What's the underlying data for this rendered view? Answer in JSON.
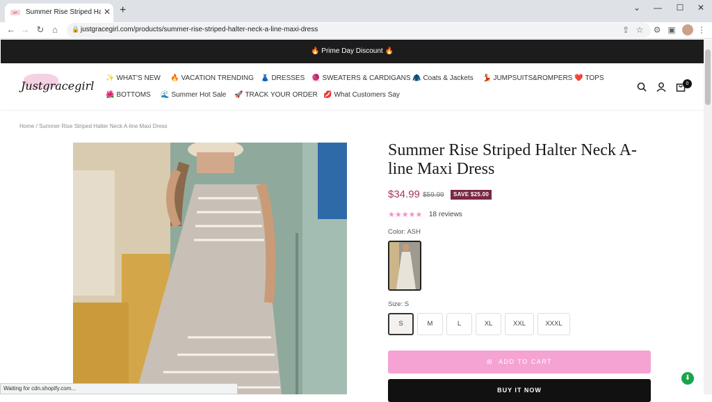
{
  "browser": {
    "tab_title": "Summer Rise Striped Halter Neck A-line Maxi Dress",
    "tab_favicon_text": "jgirl",
    "url": "justgracegirl.com/products/summer-rise-striped-halter-neck-a-line-maxi-dress",
    "new_tab": "+",
    "close": "✕",
    "minimize": "—",
    "maximize": "☐",
    "window_close": "✕",
    "collapse": "⌄"
  },
  "announcement": "🔥 Prime Day Discount 🔥",
  "header": {
    "logo_text": "Justgracegirl",
    "menu": [
      {
        "icon": "✨",
        "label": "WHAT'S NEW"
      },
      {
        "icon": "🔥",
        "label": "VACATION TRENDING"
      },
      {
        "icon": "👗",
        "label": "DRESSES"
      },
      {
        "icon": "🧶",
        "label": "SWEATERS & CARDIGANS"
      },
      {
        "icon": "🧥",
        "label": "Coats & Jackets"
      },
      {
        "icon": "💃",
        "label": "JUMPSUITS&ROMPERS"
      },
      {
        "icon": "❤️",
        "label": "TOPS"
      },
      {
        "icon": "🌺",
        "label": "BOTTOMS"
      },
      {
        "icon": "🌊",
        "label": "Summer Hot Sale"
      },
      {
        "icon": "🚀",
        "label": "TRACK YOUR ORDER"
      },
      {
        "icon": "💋",
        "label": "What Customers Say"
      }
    ],
    "cart_count": "0"
  },
  "breadcrumb": {
    "home": "Home",
    "sep": "/",
    "current": "Summer Rise Striped Halter Neck A-line Maxi Dress"
  },
  "product": {
    "title": "Summer Rise Striped Halter Neck A-line Maxi Dress",
    "price": "$34.99",
    "compare_price": "$59.99",
    "save_badge": "SAVE $25.00",
    "rating_stars": 5,
    "reviews": "18 reviews",
    "color_label": "Color:",
    "color_value": "ASH",
    "size_label": "Size:",
    "size_value": "S",
    "sizes": [
      "S",
      "M",
      "L",
      "XL",
      "XXL",
      "XXXL"
    ],
    "selected_size": "S",
    "add_to_cart": "ADD TO CART",
    "buy_now": "BUY IT NOW"
  },
  "status_bar": "Waiting for cdn.shopify.com...",
  "colors": {
    "accent_pink": "#f5a3d2",
    "price": "#a8345e",
    "save_badge": "#7a2746",
    "announce_bg": "#1c1c1c"
  }
}
